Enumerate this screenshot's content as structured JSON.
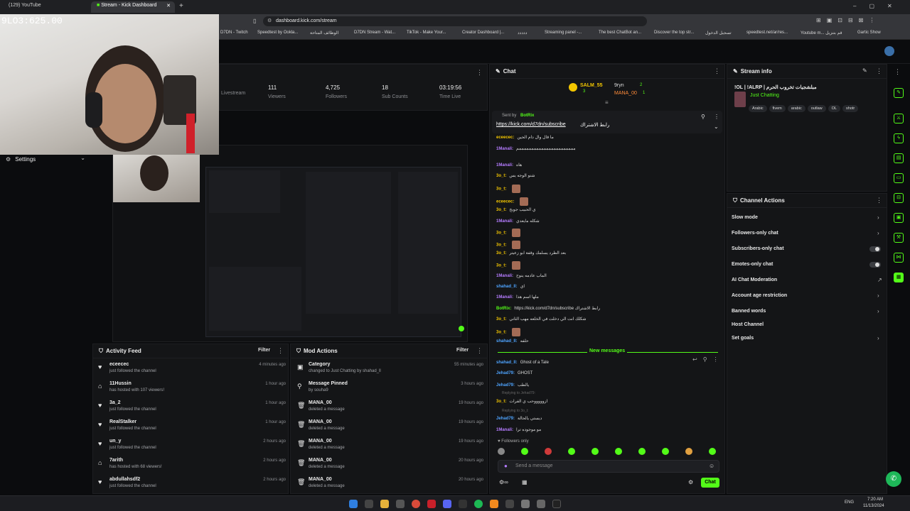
{
  "browser": {
    "tabs": [
      {
        "label": "(129) YouTube",
        "active": false
      },
      {
        "label": "Stream - Kick Dashboard",
        "active": true
      }
    ],
    "url": "dashboard.kick.com/stream",
    "bookmarks": [
      "D7DN - Twitch",
      "Speedtest by Ookla...",
      "الوظائف المتاحة",
      "D7DN Stream - Wat...",
      "TikTok - Make Your...",
      "Creator Dashboard |...",
      "ددددد",
      "Streaming panel -...",
      "The best ChatBot an...",
      "Discover the top str...",
      "تسجيل الدخول",
      "speedtest.net/ar/res...",
      "Youtube m... قم بتنزيل",
      "Gartic Show"
    ]
  },
  "overlay": {
    "timer": "9LO3:625.00"
  },
  "stats": [
    {
      "value": "",
      "label": "Livestream"
    },
    {
      "value": "111",
      "label": "Viewers"
    },
    {
      "value": "4,725",
      "label": "Followers"
    },
    {
      "value": "18",
      "label": "Sub Counts"
    },
    {
      "value": "03:19:56",
      "label": "Time Live"
    }
  ],
  "settings_label": "Settings",
  "chat": {
    "title": "Chat",
    "top_gifters": [
      "SALM_55",
      "9ryn",
      "MANA_00"
    ],
    "gifter_counts": [
      "3",
      "2",
      "1"
    ],
    "pinned_by": "Sent by",
    "pinned_user": "BotRix",
    "pinned_link": "https://kick.com/d7dn/subscribe",
    "pinned_text": "رابط الاشتراك",
    "lines": [
      {
        "user": "eceecec:",
        "text": "ما قال وال دام الحين",
        "color": "yellow"
      },
      {
        "user": "1Manali:",
        "text": "مممممممممممممممممممممممم",
        "color": "purple"
      },
      {
        "user": "1Manali:",
        "text": "هاه",
        "color": "purple"
      },
      {
        "user": "3o_t:",
        "text": "شنو الوجه يس",
        "color": "yellow"
      },
      {
        "user": "3o_t:",
        "text": "",
        "color": "yellow"
      },
      {
        "user": "eceecec:",
        "text": "",
        "color": "yellow"
      },
      {
        "user": "3o_t:",
        "text": "ي الحبيب جوبخ",
        "color": "yellow"
      },
      {
        "user": "1Manali:",
        "text": "شكله مايعدي",
        "color": "purple"
      },
      {
        "user": "3o_t:",
        "text": "",
        "color": "yellow"
      },
      {
        "user": "3o_t:",
        "text": "",
        "color": "yellow"
      },
      {
        "user": "3o_t:",
        "text": "بعد الطرد يسلمك وقفة ابو زعيتر",
        "color": "yellow"
      },
      {
        "user": "3o_t:",
        "text": "",
        "color": "yellow"
      },
      {
        "user": "1Manali:",
        "text": "الماب عادمه ينوح",
        "color": "purple"
      },
      {
        "user": "shahad_ll:",
        "text": "اي",
        "color": "blue"
      },
      {
        "user": "1Manali:",
        "text": "ملها اسم هذا",
        "color": "purple"
      },
      {
        "user": "BotRix:",
        "text": "https://kick.com/d7dn/subscribe رابط الاشتراك",
        "color": "green"
      },
      {
        "user": "3o_t:",
        "text": "شكلك انت الي دخلت في الخلعه مهب الثاني",
        "color": "yellow"
      },
      {
        "user": "3o_t:",
        "text": "",
        "color": "yellow"
      },
      {
        "user": "shahad_ll:",
        "text": "حلفه",
        "color": "blue"
      }
    ],
    "new_messages": "New messages",
    "new_lines": [
      {
        "user": "shahad_ll:",
        "text": "Ghost of a Tale",
        "color": "blue"
      },
      {
        "user": "Jehad79:",
        "text": "GHOST",
        "color": "blue"
      },
      {
        "user": "Jehad79:",
        "text": "يالطب",
        "color": "blue"
      },
      {
        "user": "3o_t:",
        "text": "ازوووووحب ي الفرات",
        "color": "yellow"
      },
      {
        "user": "Jehad79:",
        "text": "ديستي يالحالة",
        "color": "blue"
      },
      {
        "user": "1Manali:",
        "text": "مو موجوده ترا",
        "color": "purple"
      }
    ],
    "replying_1": "Replying to Jehad79:",
    "replying_2": "Replying to 3o_t:",
    "followers_only": "Followers only",
    "input_placeholder": "Send a message",
    "send_label": "Chat"
  },
  "stream_info": {
    "title": "Stream info",
    "stream_title": "!OL | !ALRP | مبلشجيات تخروب الحرم",
    "category": "Just Chatting",
    "tags": [
      "Arabic",
      "fivem",
      "arabic",
      "outlaw",
      "OL",
      "shotr"
    ]
  },
  "channel_actions": {
    "title": "Channel Actions",
    "items": [
      {
        "label": "Slow mode",
        "type": "chevron"
      },
      {
        "label": "Followers-only chat",
        "type": "chevron"
      },
      {
        "label": "Subscribers-only chat",
        "type": "toggle"
      },
      {
        "label": "Emotes-only chat",
        "type": "toggle"
      },
      {
        "label": "AI Chat Moderation",
        "type": "external"
      },
      {
        "label": "Account age restriction",
        "type": "chevron"
      },
      {
        "label": "Banned words",
        "type": "chevron"
      },
      {
        "label": "Host Channel",
        "type": "none"
      },
      {
        "label": "Set goals",
        "type": "chevron"
      }
    ]
  },
  "activity_feed": {
    "title": "Activity Feed",
    "filter": "Filter",
    "items": [
      {
        "name": "eceecec",
        "sub": "just followed the channel",
        "time": "4 minutes ago",
        "icon": "heart"
      },
      {
        "name": "11Hussin",
        "sub": "has hosted with 107 viewers!",
        "time": "1 hour ago",
        "icon": "host"
      },
      {
        "name": "3a_2",
        "sub": "just followed the channel",
        "time": "1 hour ago",
        "icon": "heart"
      },
      {
        "name": "RealStalker",
        "sub": "just followed the channel",
        "time": "1 hour ago",
        "icon": "heart"
      },
      {
        "name": "un_y",
        "sub": "just followed the channel",
        "time": "2 hours ago",
        "icon": "heart"
      },
      {
        "name": "7arith",
        "sub": "has hosted with 68 viewers!",
        "time": "2 hours ago",
        "icon": "host"
      },
      {
        "name": "abdullahsdf2",
        "sub": "just followed the channel",
        "time": "2 hours ago",
        "icon": "heart"
      }
    ]
  },
  "mod_actions": {
    "title": "Mod Actions",
    "filter": "Filter",
    "items": [
      {
        "name": "Category",
        "sub": "changed to Just Chatting by shahad_ll",
        "time": "55 minutes ago",
        "icon": "category"
      },
      {
        "name": "Message Pinned",
        "sub": "by souha9",
        "time": "3 hours ago",
        "icon": "pin"
      },
      {
        "name": "MANA_00",
        "sub": "deleted a message",
        "time": "19 hours ago",
        "icon": "trash"
      },
      {
        "name": "MANA_00",
        "sub": "deleted a message",
        "time": "19 hours ago",
        "icon": "trash"
      },
      {
        "name": "MANA_00",
        "sub": "deleted a message",
        "time": "19 hours ago",
        "icon": "trash"
      },
      {
        "name": "MANA_00",
        "sub": "deleted a message",
        "time": "20 hours ago",
        "icon": "trash"
      },
      {
        "name": "MANA_00",
        "sub": "deleted a message",
        "time": "20 hours ago",
        "icon": "trash"
      }
    ]
  },
  "taskbar": {
    "lang": "ENG",
    "time": "7:20 AM",
    "date": "11/13/2024"
  },
  "colors": {
    "kick_green": "#53fc18",
    "panel_bg": "#141517",
    "page_bg": "#0b0c0e"
  }
}
